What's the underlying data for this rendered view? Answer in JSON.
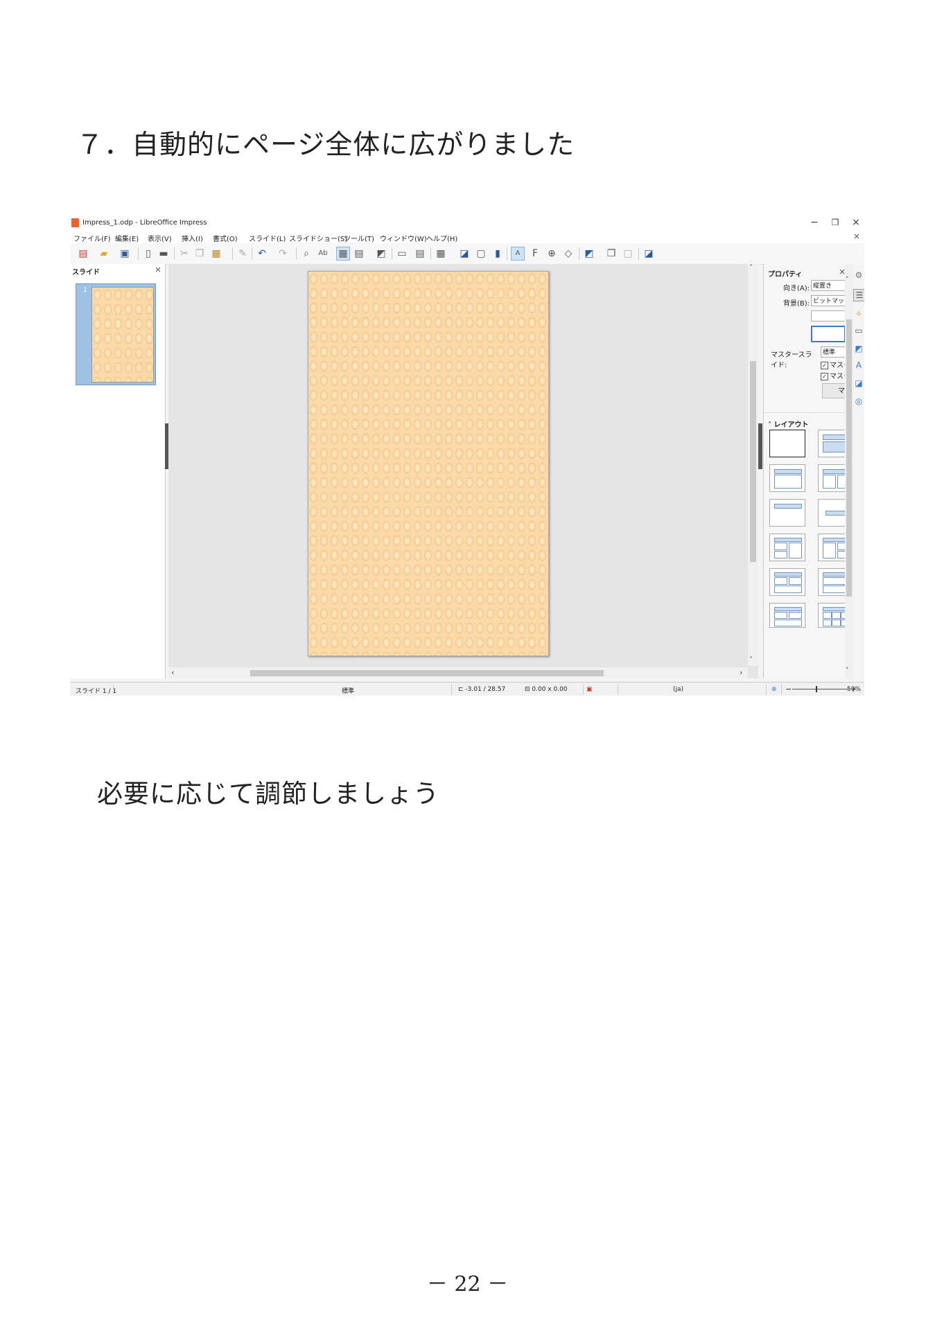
{
  "heading": "７．自動的にページ全体に広がりました",
  "note": "必要に応じて調節しましょう",
  "page_number": "－ 22 －",
  "screenshot": {
    "window_title": "Impress_1.odp - LibreOffice Impress",
    "window_controls": {
      "minimize": "−",
      "restore": "❐",
      "close": "×"
    },
    "menu": [
      "ファイル(F)",
      "編集(E)",
      "表示(V)",
      "挿入(I)",
      "書式(O)",
      "スライド(L)",
      "スライドショー(S)",
      "ツール(T)",
      "ウィンドウ(W)",
      "ヘルプ(H)"
    ],
    "doc_close": "×",
    "toolbar_icons": [
      "new-icon",
      "open-icon",
      "save-icon",
      "export-pdf-icon",
      "print-icon",
      "cut-icon",
      "copy-icon",
      "paste-icon",
      "clone-formatting-icon",
      "undo-icon",
      "redo-icon",
      "find-replace-icon",
      "spelling-icon",
      "grid-icon",
      "display-views-icon",
      "image-icon",
      "master-slide-icon",
      "slide-layout-icon",
      "table-icon",
      "insert-image-icon",
      "frame-icon",
      "chart-icon",
      "text-box-icon",
      "fontwork-icon",
      "hyperlink-icon",
      "shapes-icon",
      "transform-icon",
      "arrange-icon",
      "shadow-icon",
      "line-icon"
    ],
    "slide_pane": {
      "title": "スライド",
      "close": "×",
      "slide_number": "1"
    },
    "sidebar": {
      "section_title": "プロパティ",
      "close": "×",
      "orientation_label": "向き(A):",
      "orientation_value": "縦置き",
      "background_label": "背景(B):",
      "background_value": "ビットマップ",
      "master_label": "マスタースライド:",
      "master_value": "標準",
      "check1": "マスタースライドの背景",
      "check2": "マスタースライドのオブジェクト",
      "master_button": "マスター表示",
      "layout_title": "レイアウト"
    },
    "deck_icons": [
      "settings-icon",
      "properties-icon",
      "slide-transition-icon",
      "animation-icon",
      "master-slides-icon",
      "styles-icon",
      "gallery-icon",
      "navigator-icon"
    ],
    "status": {
      "slide": "スライド 1 / 1",
      "master": "標準",
      "position": "-3.01 / 28.57",
      "size": "0.00 x 0.00",
      "lang": "(ja)",
      "zoom_minus": "−",
      "zoom_plus": "+",
      "zoom": "59%",
      "zoom_level": 0.42
    },
    "colors": {
      "slide_bg": "#fbd9a8",
      "pattern": "#f2c487",
      "selection": "#9fc1e3",
      "accent": "#3b7ad0"
    }
  }
}
